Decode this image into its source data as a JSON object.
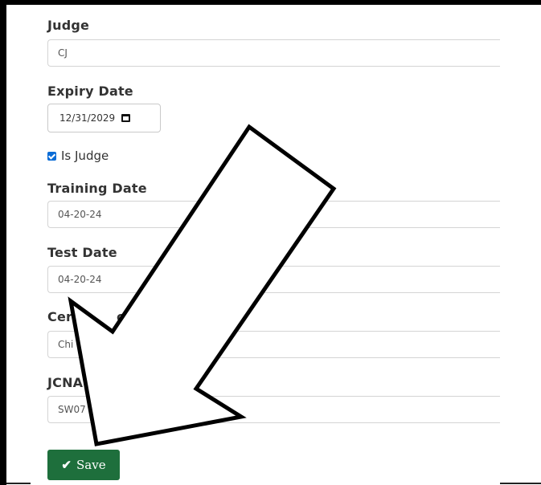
{
  "form": {
    "judge": {
      "label": "Judge",
      "value": "CJ"
    },
    "expiry": {
      "label": "Expiry Date",
      "value": "12/31/2029"
    },
    "is_judge": {
      "label": "Is Judge",
      "checked": true
    },
    "training": {
      "label": "Training Date",
      "value": "04-20-24"
    },
    "test": {
      "label": "Test Date",
      "value": "04-20-24"
    },
    "certification": {
      "label_visible": "Cer",
      "label_visible_2": "cati",
      "value_visible": "Chi"
    },
    "jcna": {
      "label_visible": "JCNA",
      "value_visible": "SW07"
    },
    "save_label": "Save"
  },
  "colors": {
    "save_button": "#1e6f3c",
    "checkbox": "#0a6cd6"
  },
  "icons": {
    "calendar": "calendar-icon",
    "check": "checkmark-icon",
    "arrow": "arrow-annotation"
  }
}
